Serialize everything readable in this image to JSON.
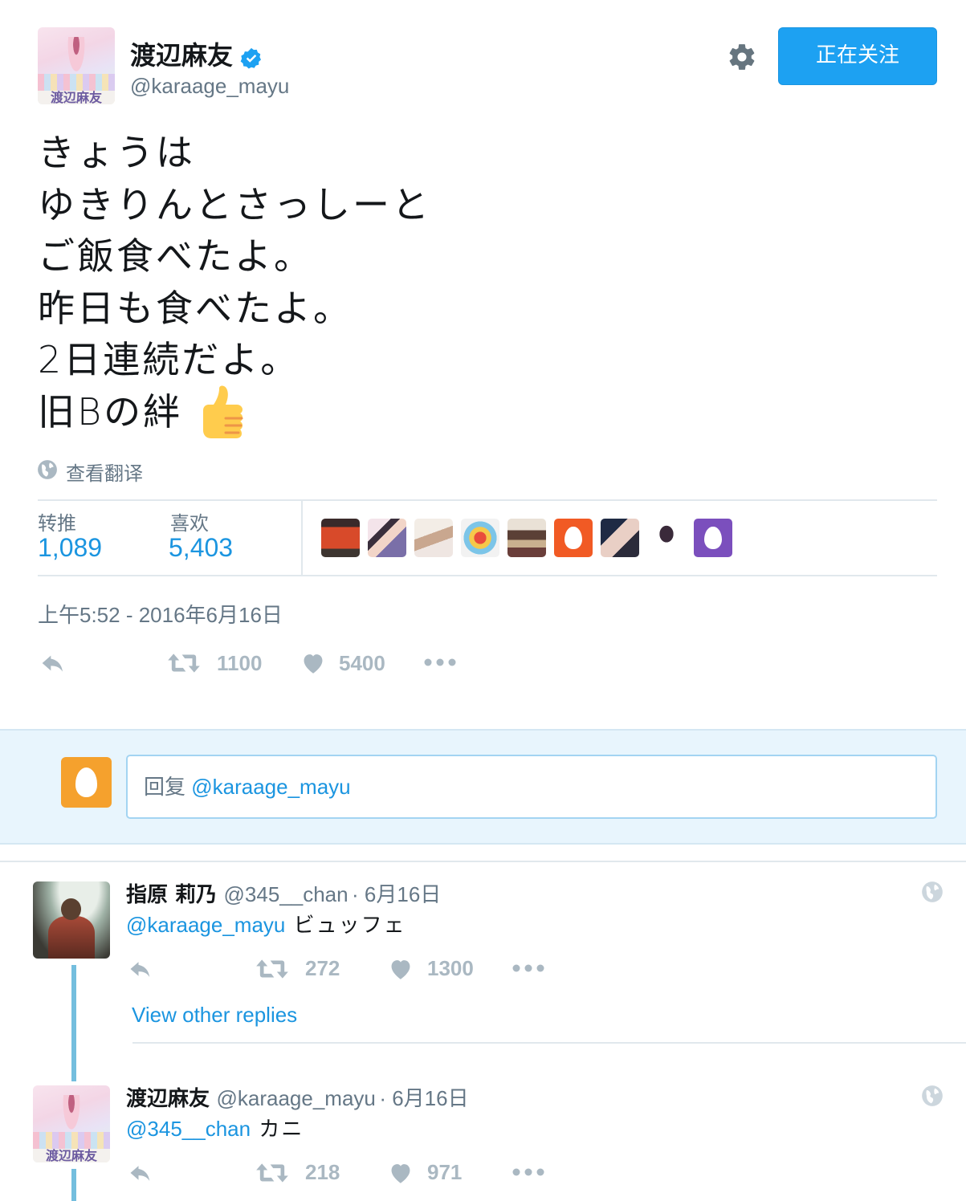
{
  "header": {
    "display_name": "渡辺麻友",
    "handle": "@karaage_mayu",
    "follow_label": "正在关注",
    "avatar_caption": "渡辺麻友"
  },
  "tweet": {
    "lines": [
      "きょうは",
      "ゆきりんとさっしーと",
      "ご飯食べたよ。",
      "昨日も食べたよ。",
      "2日連続だよ。",
      "旧Bの絆"
    ],
    "emoji": "thumbs-up",
    "translate_label": "查看翻译",
    "timestamp": "上午5:52 - 2016年6月16日"
  },
  "stats": {
    "retweets_label": "转推",
    "retweets": "1,089",
    "likes_label": "喜欢",
    "likes": "5,403"
  },
  "actions": {
    "retweet_count": "1100",
    "like_count": "5400"
  },
  "reply_box": {
    "prefix": "回复",
    "mention": "@karaage_mayu"
  },
  "replies": [
    {
      "name": "指原 莉乃",
      "handle": "@345__chan",
      "date": "· 6月16日",
      "mention": "@karaage_mayu",
      "text": "ビュッフェ",
      "retweets": "272",
      "likes": "1300",
      "more_link": "View other replies"
    },
    {
      "name": "渡辺麻友",
      "handle": "@karaage_mayu",
      "date": "· 6月16日",
      "mention": "@345__chan",
      "text": "カニ",
      "retweets": "218",
      "likes": "971"
    }
  ],
  "colors": {
    "accent": "#1da1f2",
    "link": "#1b95e0",
    "muted": "#657786",
    "action_gray": "#aab8c2",
    "egg_orange": "#f5a12d",
    "egg_purple": "#7b4fbd",
    "reply_band": "#e8f5fd",
    "thread_line": "#74bede"
  }
}
